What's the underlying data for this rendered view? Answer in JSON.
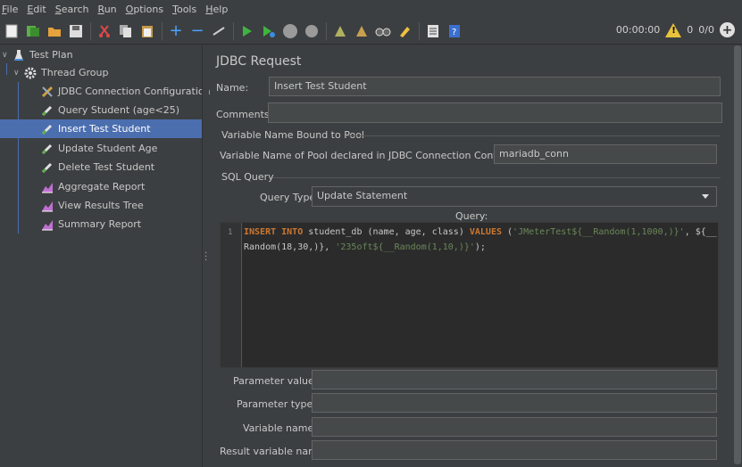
{
  "menu": [
    {
      "label": "File",
      "mnemonic": "F",
      "rest": "ile"
    },
    {
      "label": "Edit",
      "mnemonic": "E",
      "rest": "dit"
    },
    {
      "label": "Search",
      "mnemonic": "S",
      "rest": "earch"
    },
    {
      "label": "Run",
      "mnemonic": "R",
      "rest": "un"
    },
    {
      "label": "Options",
      "mnemonic": "O",
      "rest": "ptions"
    },
    {
      "label": "Tools",
      "mnemonic": "T",
      "rest": "ools"
    },
    {
      "label": "Help",
      "mnemonic": "H",
      "rest": "elp"
    }
  ],
  "toolbar": {
    "timer": "00:00:00",
    "warning_count": "0",
    "threads": "0/0"
  },
  "tree": {
    "items": [
      {
        "label": "Test Plan"
      },
      {
        "label": "Thread Group"
      },
      {
        "label": "JDBC Connection Configuration"
      },
      {
        "label": "Query Student (age<25)"
      },
      {
        "label": "Insert Test Student"
      },
      {
        "label": "Update Student Age"
      },
      {
        "label": "Delete Test Student"
      },
      {
        "label": "Aggregate Report"
      },
      {
        "label": "View Results Tree"
      },
      {
        "label": "Summary Report"
      }
    ]
  },
  "form": {
    "title": "JDBC Request",
    "name_label": "Name:",
    "name_value": "Insert Test Student",
    "comments_label": "Comments:",
    "comments_value": "",
    "pool_section": "Variable Name Bound to Pool",
    "pool_label": "Variable Name of Pool declared in JDBC Connection Configuration:",
    "pool_value": "mariadb_conn",
    "sql_section": "SQL Query",
    "query_type_label": "Query Type:",
    "query_type_value": "Update Statement",
    "query_label": "Query:",
    "line_number": "1",
    "code": {
      "kw1": "INSERT INTO",
      "t1": " student_db (name, age, class) ",
      "kw2": "VALUES",
      "t2": " (",
      "s1": "'JMeterTest${__Random(1,1000,)}'",
      "t3": ", ${__",
      "t4": "Random(18,30,)}, ",
      "s2": "'235oft${__Random(1,10,)}'",
      "t5": ");"
    },
    "param_values_label": "Parameter values:",
    "param_types_label": "Parameter types:",
    "variable_names_label": "Variable names:",
    "result_variable_label": "Result variable name:"
  },
  "colors": {
    "selection": "#4b6eaf",
    "keyword": "#cc7832",
    "string": "#6a8759"
  },
  "icons": {
    "test_plan": "flask-icon",
    "thread_group": "gear-icon",
    "jdbc_config": "wrench-icon",
    "sampler": "pipette-icon",
    "report": "chart-icon"
  }
}
